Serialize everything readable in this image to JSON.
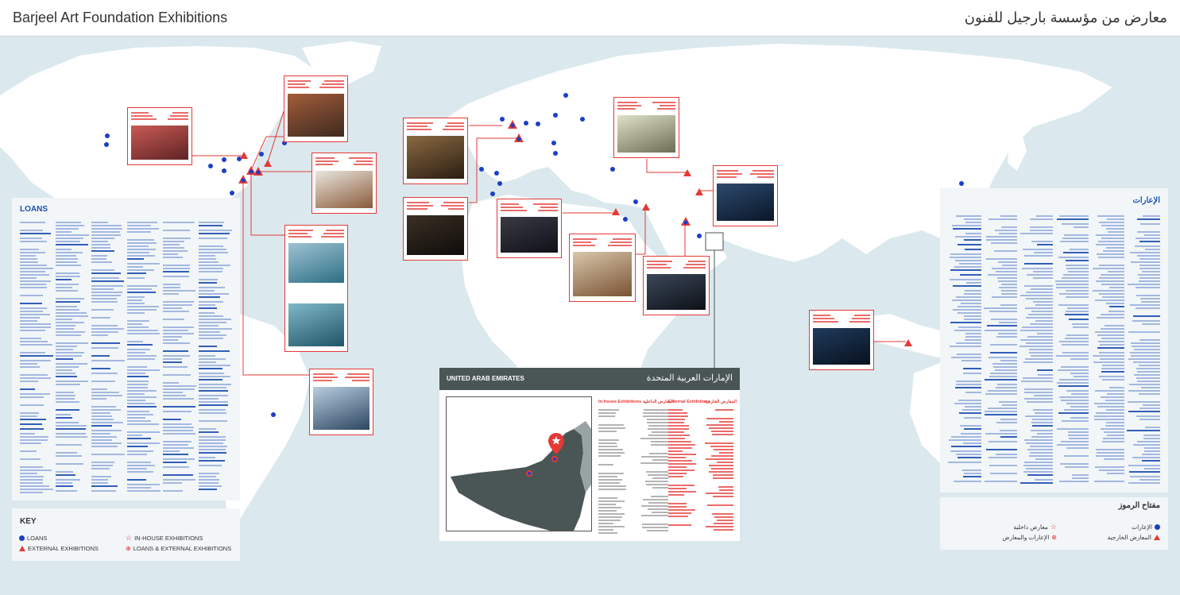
{
  "header": {
    "title_en": "Barjeel Art Foundation Exhibitions",
    "title_ar": "معارض من مؤسسة بارجيل للفنون"
  },
  "panels": {
    "loans_title": "LOANS",
    "loans_title_ar": "الإعارات"
  },
  "key": {
    "title": "KEY",
    "title_ar": "مفتاح الرموز",
    "loans": "LOANS",
    "external": "EXTERNAL EXHIBITIONS",
    "inhouse": "IN-HOUSE EXHIBITIONS",
    "loans_external": "LOANS & EXTERNAL EXHIBITIONS",
    "loans_ar": "الإعارات",
    "external_ar": "المعارض الخارجية",
    "inhouse_ar": "معارض داخلية",
    "loans_external_ar": "الإعارات والمعارض"
  },
  "uae": {
    "title_en": "UNITED ARAB EMIRATES",
    "title_ar": "الإمارات العربية المتحدة",
    "col1_head": "In-house Exhibitions",
    "col2_head": "المعارض الداخلية",
    "col3_head": "External Exhibitions",
    "col4_head": "المعارض الخارجية"
  },
  "colors": {
    "water": "#dbe9ee",
    "land": "#ffffff",
    "loan": "#1c3fc7",
    "exhibition": "#e53935",
    "uae_land": "#4a5556"
  }
}
